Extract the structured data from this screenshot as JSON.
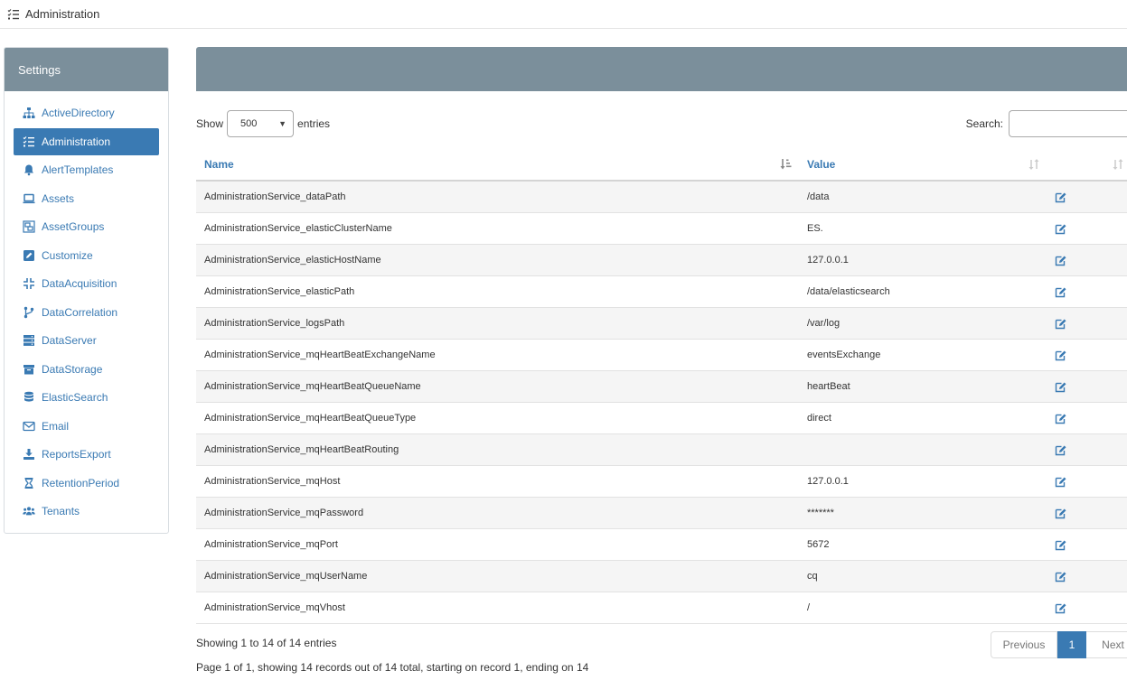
{
  "header": {
    "title": "Administration",
    "icon": "list-check-icon"
  },
  "sidebar": {
    "title": "Settings",
    "items": [
      {
        "label": "ActiveDirectory",
        "icon": "sitemap-icon",
        "active": false
      },
      {
        "label": "Administration",
        "icon": "list-check-icon",
        "active": true
      },
      {
        "label": "AlertTemplates",
        "icon": "bell-icon",
        "active": false
      },
      {
        "label": "Assets",
        "icon": "laptop-icon",
        "active": false
      },
      {
        "label": "AssetGroups",
        "icon": "object-group-icon",
        "active": false
      },
      {
        "label": "Customize",
        "icon": "edit-square-icon",
        "active": false
      },
      {
        "label": "DataAcquisition",
        "icon": "compress-icon",
        "active": false
      },
      {
        "label": "DataCorrelation",
        "icon": "code-branch-icon",
        "active": false
      },
      {
        "label": "DataServer",
        "icon": "server-icon",
        "active": false
      },
      {
        "label": "DataStorage",
        "icon": "archive-icon",
        "active": false
      },
      {
        "label": "ElasticSearch",
        "icon": "database-icon",
        "active": false
      },
      {
        "label": "Email",
        "icon": "envelope-icon",
        "active": false
      },
      {
        "label": "ReportsExport",
        "icon": "download-icon",
        "active": false
      },
      {
        "label": "RetentionPeriod",
        "icon": "hourglass-icon",
        "active": false
      },
      {
        "label": "Tenants",
        "icon": "users-icon",
        "active": false
      }
    ]
  },
  "controls": {
    "show_label": "Show",
    "entries_value": "500",
    "entries_label": "entries",
    "search_label": "Search:"
  },
  "table": {
    "columns": {
      "name": "Name",
      "value": "Value"
    },
    "rows": [
      {
        "name": "AdministrationService_dataPath",
        "value": "/data"
      },
      {
        "name": "AdministrationService_elasticClusterName",
        "value": "ES."
      },
      {
        "name": "AdministrationService_elasticHostName",
        "value": "127.0.0.1"
      },
      {
        "name": "AdministrationService_elasticPath",
        "value": "/data/elasticsearch"
      },
      {
        "name": "AdministrationService_logsPath",
        "value": "/var/log"
      },
      {
        "name": "AdministrationService_mqHeartBeatExchangeName",
        "value": "eventsExchange"
      },
      {
        "name": "AdministrationService_mqHeartBeatQueueName",
        "value": "heartBeat"
      },
      {
        "name": "AdministrationService_mqHeartBeatQueueType",
        "value": "direct"
      },
      {
        "name": "AdministrationService_mqHeartBeatRouting",
        "value": ""
      },
      {
        "name": "AdministrationService_mqHost",
        "value": "127.0.0.1"
      },
      {
        "name": "AdministrationService_mqPassword",
        "value": "*******"
      },
      {
        "name": "AdministrationService_mqPort",
        "value": "5672"
      },
      {
        "name": "AdministrationService_mqUserName",
        "value": "cq"
      },
      {
        "name": "AdministrationService_mqVhost",
        "value": "/"
      }
    ]
  },
  "footer": {
    "info": "Showing 1 to 14 of 14 entries",
    "detail": "Page 1 of 1, showing 14 records out of 14 total, starting on record 1, ending on 14"
  },
  "pagination": {
    "previous": "Previous",
    "current": "1",
    "next": "Next"
  },
  "colors": {
    "accent": "#3a7ab3",
    "header_bg": "#7b8f9b",
    "row_alt": "#f5f5f5"
  }
}
